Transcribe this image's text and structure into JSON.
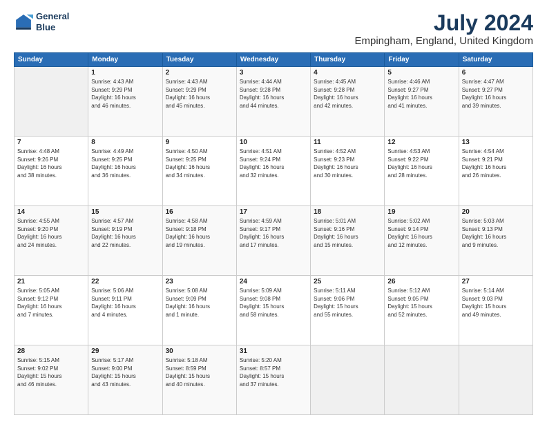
{
  "header": {
    "logo_line1": "General",
    "logo_line2": "Blue",
    "title": "July 2024",
    "subtitle": "Empingham, England, United Kingdom"
  },
  "columns": [
    "Sunday",
    "Monday",
    "Tuesday",
    "Wednesday",
    "Thursday",
    "Friday",
    "Saturday"
  ],
  "weeks": [
    [
      {
        "day": "",
        "info": ""
      },
      {
        "day": "1",
        "info": "Sunrise: 4:43 AM\nSunset: 9:29 PM\nDaylight: 16 hours\nand 46 minutes."
      },
      {
        "day": "2",
        "info": "Sunrise: 4:43 AM\nSunset: 9:29 PM\nDaylight: 16 hours\nand 45 minutes."
      },
      {
        "day": "3",
        "info": "Sunrise: 4:44 AM\nSunset: 9:28 PM\nDaylight: 16 hours\nand 44 minutes."
      },
      {
        "day": "4",
        "info": "Sunrise: 4:45 AM\nSunset: 9:28 PM\nDaylight: 16 hours\nand 42 minutes."
      },
      {
        "day": "5",
        "info": "Sunrise: 4:46 AM\nSunset: 9:27 PM\nDaylight: 16 hours\nand 41 minutes."
      },
      {
        "day": "6",
        "info": "Sunrise: 4:47 AM\nSunset: 9:27 PM\nDaylight: 16 hours\nand 39 minutes."
      }
    ],
    [
      {
        "day": "7",
        "info": "Sunrise: 4:48 AM\nSunset: 9:26 PM\nDaylight: 16 hours\nand 38 minutes."
      },
      {
        "day": "8",
        "info": "Sunrise: 4:49 AM\nSunset: 9:25 PM\nDaylight: 16 hours\nand 36 minutes."
      },
      {
        "day": "9",
        "info": "Sunrise: 4:50 AM\nSunset: 9:25 PM\nDaylight: 16 hours\nand 34 minutes."
      },
      {
        "day": "10",
        "info": "Sunrise: 4:51 AM\nSunset: 9:24 PM\nDaylight: 16 hours\nand 32 minutes."
      },
      {
        "day": "11",
        "info": "Sunrise: 4:52 AM\nSunset: 9:23 PM\nDaylight: 16 hours\nand 30 minutes."
      },
      {
        "day": "12",
        "info": "Sunrise: 4:53 AM\nSunset: 9:22 PM\nDaylight: 16 hours\nand 28 minutes."
      },
      {
        "day": "13",
        "info": "Sunrise: 4:54 AM\nSunset: 9:21 PM\nDaylight: 16 hours\nand 26 minutes."
      }
    ],
    [
      {
        "day": "14",
        "info": "Sunrise: 4:55 AM\nSunset: 9:20 PM\nDaylight: 16 hours\nand 24 minutes."
      },
      {
        "day": "15",
        "info": "Sunrise: 4:57 AM\nSunset: 9:19 PM\nDaylight: 16 hours\nand 22 minutes."
      },
      {
        "day": "16",
        "info": "Sunrise: 4:58 AM\nSunset: 9:18 PM\nDaylight: 16 hours\nand 19 minutes."
      },
      {
        "day": "17",
        "info": "Sunrise: 4:59 AM\nSunset: 9:17 PM\nDaylight: 16 hours\nand 17 minutes."
      },
      {
        "day": "18",
        "info": "Sunrise: 5:01 AM\nSunset: 9:16 PM\nDaylight: 16 hours\nand 15 minutes."
      },
      {
        "day": "19",
        "info": "Sunrise: 5:02 AM\nSunset: 9:14 PM\nDaylight: 16 hours\nand 12 minutes."
      },
      {
        "day": "20",
        "info": "Sunrise: 5:03 AM\nSunset: 9:13 PM\nDaylight: 16 hours\nand 9 minutes."
      }
    ],
    [
      {
        "day": "21",
        "info": "Sunrise: 5:05 AM\nSunset: 9:12 PM\nDaylight: 16 hours\nand 7 minutes."
      },
      {
        "day": "22",
        "info": "Sunrise: 5:06 AM\nSunset: 9:11 PM\nDaylight: 16 hours\nand 4 minutes."
      },
      {
        "day": "23",
        "info": "Sunrise: 5:08 AM\nSunset: 9:09 PM\nDaylight: 16 hours\nand 1 minute."
      },
      {
        "day": "24",
        "info": "Sunrise: 5:09 AM\nSunset: 9:08 PM\nDaylight: 15 hours\nand 58 minutes."
      },
      {
        "day": "25",
        "info": "Sunrise: 5:11 AM\nSunset: 9:06 PM\nDaylight: 15 hours\nand 55 minutes."
      },
      {
        "day": "26",
        "info": "Sunrise: 5:12 AM\nSunset: 9:05 PM\nDaylight: 15 hours\nand 52 minutes."
      },
      {
        "day": "27",
        "info": "Sunrise: 5:14 AM\nSunset: 9:03 PM\nDaylight: 15 hours\nand 49 minutes."
      }
    ],
    [
      {
        "day": "28",
        "info": "Sunrise: 5:15 AM\nSunset: 9:02 PM\nDaylight: 15 hours\nand 46 minutes."
      },
      {
        "day": "29",
        "info": "Sunrise: 5:17 AM\nSunset: 9:00 PM\nDaylight: 15 hours\nand 43 minutes."
      },
      {
        "day": "30",
        "info": "Sunrise: 5:18 AM\nSunset: 8:59 PM\nDaylight: 15 hours\nand 40 minutes."
      },
      {
        "day": "31",
        "info": "Sunrise: 5:20 AM\nSunset: 8:57 PM\nDaylight: 15 hours\nand 37 minutes."
      },
      {
        "day": "",
        "info": ""
      },
      {
        "day": "",
        "info": ""
      },
      {
        "day": "",
        "info": ""
      }
    ]
  ]
}
